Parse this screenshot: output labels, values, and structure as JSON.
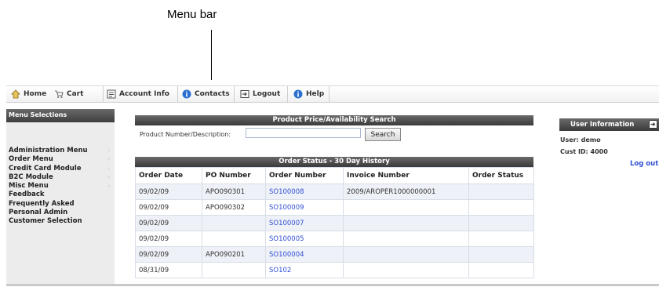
{
  "annotation": {
    "label": "Menu bar"
  },
  "menubar": {
    "items": [
      {
        "label": "Home",
        "icon": "home-icon"
      },
      {
        "label": "Cart",
        "icon": "cart-icon"
      },
      {
        "label": "Account Info",
        "icon": "account-info-icon"
      },
      {
        "label": "Contacts",
        "icon": "info-icon"
      },
      {
        "label": "Logout",
        "icon": "logout-icon"
      },
      {
        "label": "Help",
        "icon": "help-icon"
      }
    ]
  },
  "sidebar": {
    "title": "Menu Selections",
    "items": [
      {
        "label": "Administration Menu",
        "arrow": "›"
      },
      {
        "label": "Order Menu",
        "arrow": "›"
      },
      {
        "label": "Credit Card Module",
        "arrow": "›"
      },
      {
        "label": "B2C Module",
        "arrow": "›"
      },
      {
        "label": "Misc Menu",
        "arrow": "›"
      },
      {
        "label": "Feedback"
      },
      {
        "label": "Frequently Asked"
      },
      {
        "label": "Personal Admin"
      },
      {
        "label": "Customer Selection"
      }
    ]
  },
  "product_search": {
    "title": "Product Price/Availability Search",
    "label": "Product Number/Description:",
    "value": "",
    "button": "Search"
  },
  "order_status": {
    "title": "Order Status - 30 Day History",
    "columns": [
      "Order Date",
      "PO Number",
      "Order Number",
      "Invoice Number",
      "Order Status"
    ],
    "rows": [
      {
        "date": "09/02/09",
        "po": "APO090301",
        "order": "SO100008",
        "invoice": "2009/AROPER1000000001",
        "status": ""
      },
      {
        "date": "09/02/09",
        "po": "APO090302",
        "order": "SO100009",
        "invoice": "",
        "status": ""
      },
      {
        "date": "09/02/09",
        "po": "",
        "order": "SO100007",
        "invoice": "",
        "status": ""
      },
      {
        "date": "09/02/09",
        "po": "",
        "order": "SO100005",
        "invoice": "",
        "status": ""
      },
      {
        "date": "09/02/09",
        "po": "APO090201",
        "order": "SO100004",
        "invoice": "",
        "status": ""
      },
      {
        "date": "08/31/09",
        "po": "",
        "order": "SO102",
        "invoice": "",
        "status": ""
      }
    ]
  },
  "user_info": {
    "title": "User Information",
    "user": "User: demo",
    "cust_id": "Cust ID: 4000",
    "logout": "Log out"
  },
  "colors": {
    "link": "#2f4fd6",
    "header_dark": "#3e3e3e",
    "alt_row": "#eef1f7"
  }
}
